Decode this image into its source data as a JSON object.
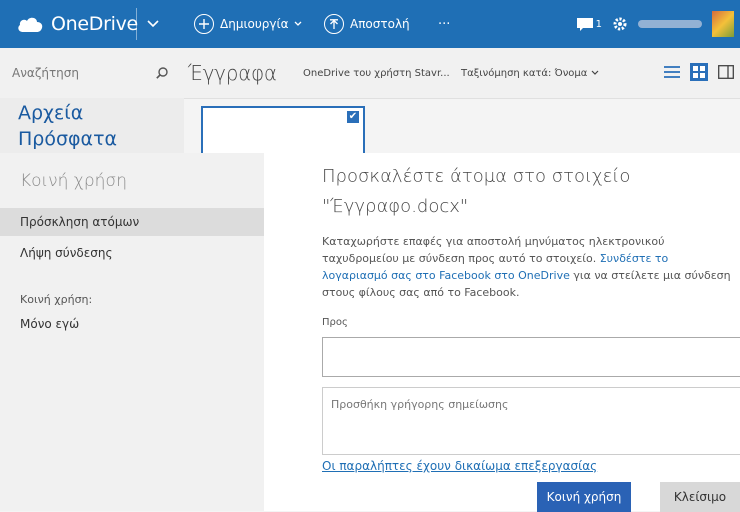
{
  "app": {
    "name": "OneDrive"
  },
  "topbar": {
    "create_label": "Δημιουργία",
    "upload_label": "Αποστολή",
    "more_label": "···",
    "notifications_count": "1"
  },
  "secbar": {
    "search_placeholder": "Αναζήτηση",
    "breadcrumb": "Έγγραφα",
    "owner": "OneDrive του χρήστη Stavr...",
    "sort_label": "Ταξινόμηση κατά: Όνομα"
  },
  "underlay": {
    "nav_files": "Αρχεία",
    "nav_recent": "Πρόσφατα"
  },
  "dialog": {
    "left_title": "Κοινή χρήση",
    "options": [
      "Πρόσκληση ατόμων",
      "Λήψη σύνδεσης"
    ],
    "selected_option": "Πρόσκληση ατόμων",
    "sharing_label": "Κοινή χρήση:",
    "sharing_value": "Μόνο εγώ",
    "title_line1": "Προσκαλέστε άτομα στο στοιχείο",
    "title_line2": "\"Έγγραφο.docx\"",
    "desc_text": "Καταχωρήστε επαφές για αποστολή μηνύματος ηλεκτρονικού ταχυδρομείου με σύνδεση προς αυτό το στοιχείο. ",
    "desc_link": "Συνδέστε το λογαριασμό σας στο Facebook στο OneDrive",
    "desc_tail": " για να στείλετε μια σύνδεση στους φίλους σας από το Facebook.",
    "to_label": "Προς",
    "to_value": "",
    "note_placeholder": "Προσθήκη γρήγορης σημείωσης",
    "permission_link": "Οι παραλήπτες έχουν δικαίωμα επεξεργασίας",
    "share_button": "Κοινή χρήση",
    "close_button": "Κλείσιμο"
  },
  "colors": {
    "brand": "#1f6fb5",
    "primary_button": "#2a62b5",
    "secondary_button": "#d8d8d8"
  }
}
